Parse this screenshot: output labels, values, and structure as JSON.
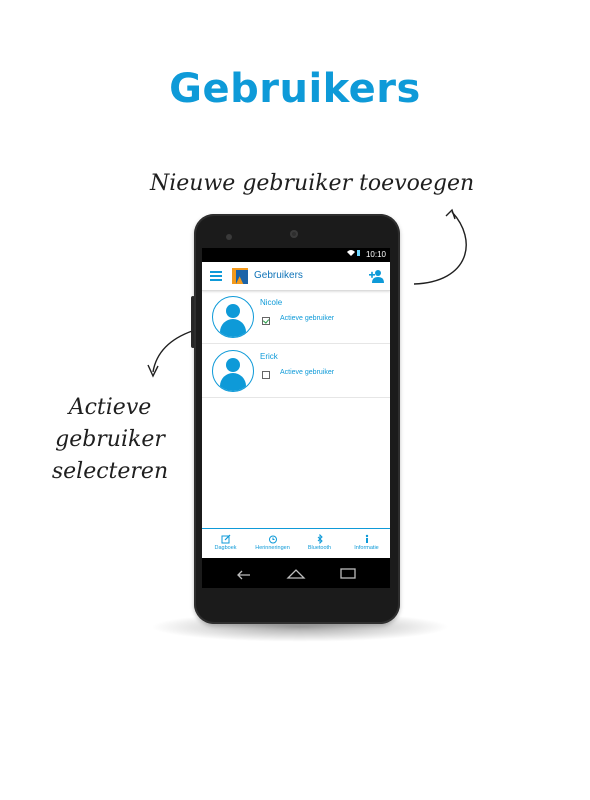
{
  "headline": "Gebruikers",
  "callouts": {
    "add_user": "Nieuwe gebruiker toevoegen",
    "select_active_user_line1": "Actieve",
    "select_active_user_line2": "gebruiker",
    "select_active_user_line3": "selecteren"
  },
  "status_bar": {
    "time": "10:10",
    "icons": [
      "wifi-icon",
      "battery-icon"
    ]
  },
  "app_bar": {
    "title": "Gebruikers",
    "menu_icon": "menu-icon",
    "logo": "app-logo",
    "action_icon": "add-user-icon"
  },
  "users": [
    {
      "name": "Nicole",
      "active_label": "Actieve gebruiker",
      "active": true
    },
    {
      "name": "Erick",
      "active_label": "Actieve gebruiker",
      "active": false
    }
  ],
  "tabs": [
    {
      "label": "Dagboek",
      "icon": "edit-icon"
    },
    {
      "label": "Herinneringen",
      "icon": "alarm-clock-icon"
    },
    {
      "label": "Bluetooth",
      "icon": "bluetooth-icon"
    },
    {
      "label": "Informatie",
      "icon": "info-icon"
    }
  ],
  "nav_bar": [
    "back-icon",
    "home-icon",
    "recents-icon"
  ],
  "colors": {
    "accent": "#0e9ad8",
    "phone_body": "#1b1b1b",
    "logo_orange": "#f39a1b",
    "logo_blue": "#1b63a8",
    "check": "#2a9d4a"
  }
}
